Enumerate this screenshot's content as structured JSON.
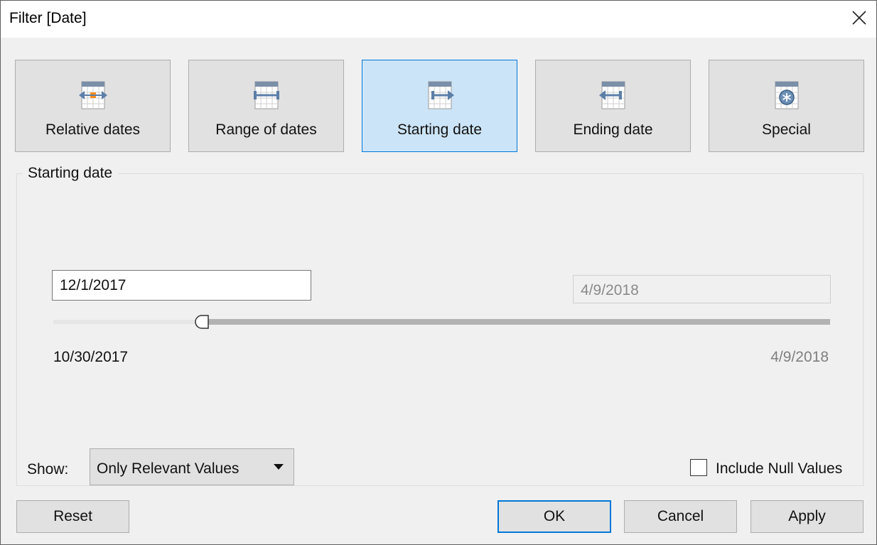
{
  "window": {
    "title": "Filter [Date]",
    "close_icon": "close-icon"
  },
  "modes": {
    "selected": "starting_date",
    "items": [
      {
        "id": "relative_dates",
        "label": "Relative dates",
        "icon": "calendar-relative-icon"
      },
      {
        "id": "range_of_dates",
        "label": "Range of dates",
        "icon": "calendar-range-icon"
      },
      {
        "id": "starting_date",
        "label": "Starting date",
        "icon": "calendar-start-icon"
      },
      {
        "id": "ending_date",
        "label": "Ending date",
        "icon": "calendar-end-icon"
      },
      {
        "id": "special",
        "label": "Special",
        "icon": "calendar-special-icon"
      }
    ]
  },
  "range": {
    "group_title": "Starting date",
    "start_value": "12/1/2017",
    "end_value": "4/9/2018",
    "min_label": "10/30/2017",
    "max_label": "4/9/2018"
  },
  "show": {
    "label": "Show:",
    "selected": "Only Relevant Values"
  },
  "include_null": {
    "label": "Include Null Values",
    "checked": false
  },
  "buttons": {
    "reset": "Reset",
    "ok": "OK",
    "cancel": "Cancel",
    "apply": "Apply"
  },
  "colors": {
    "selected_bg": "#cce4f7",
    "selected_border": "#0078d7",
    "icon_arrow": "#5b7fa8",
    "icon_marker": "#ff8c1a"
  }
}
